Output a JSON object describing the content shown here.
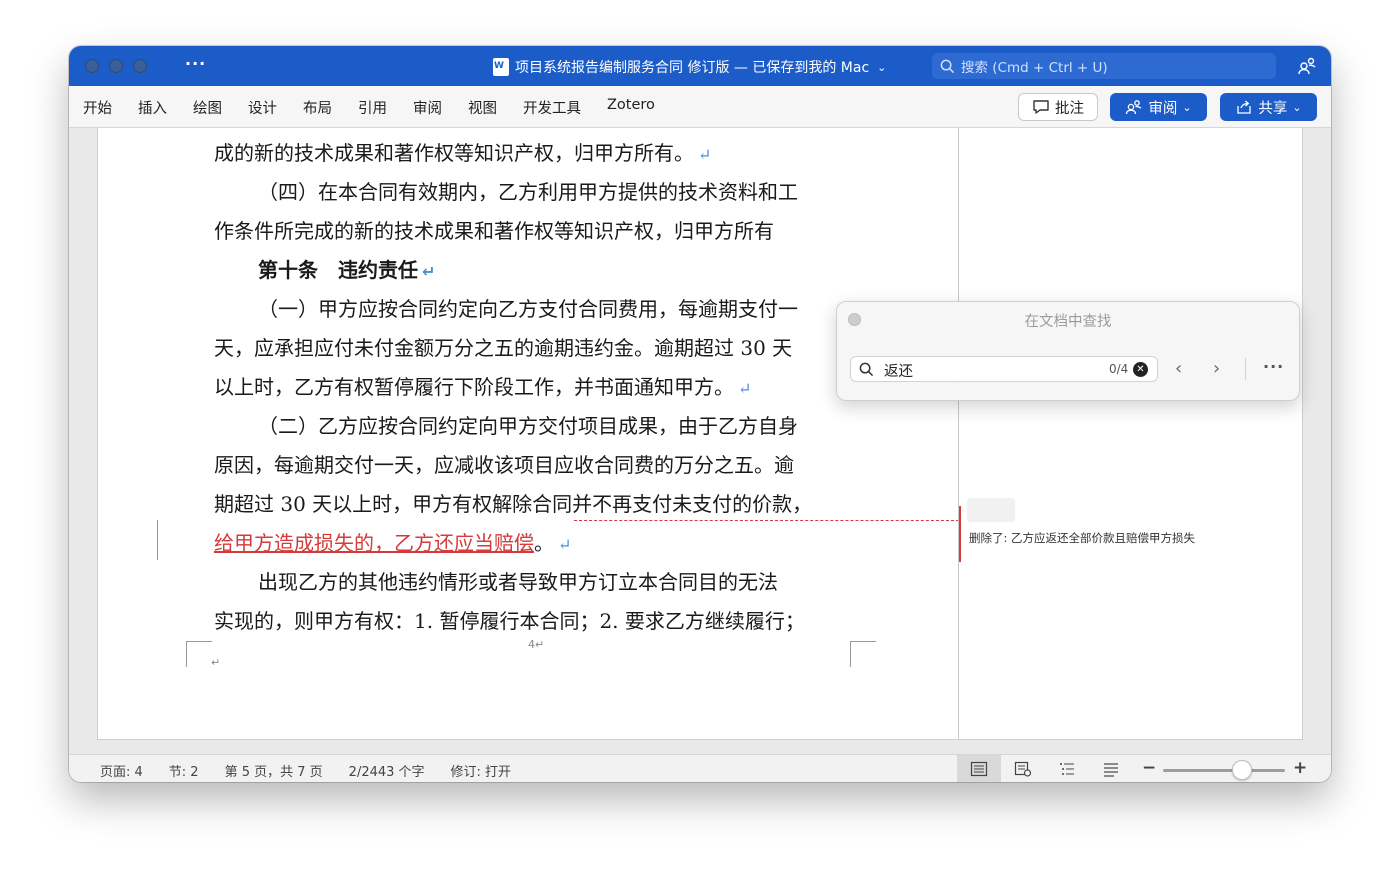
{
  "window": {
    "title": "项目系统报告编制服务合同 修订版 — 已保存到我的 Mac",
    "search_placeholder": "搜索 (Cmd + Ctrl + U)"
  },
  "ribbon": {
    "tabs": [
      "开始",
      "插入",
      "绘图",
      "设计",
      "布局",
      "引用",
      "审阅",
      "视图",
      "开发工具",
      "Zotero"
    ],
    "comment_label": "批注",
    "review_label": "审阅",
    "share_label": "共享"
  },
  "document": {
    "lines": [
      "成的新的技术成果和著作权等知识产权，归甲方所有。",
      "（四）在本合同有效期内，乙方利用甲方提供的技术资料和工",
      "作条件所完成的新的技术成果和著作权等知识产权，归甲方所有",
      "第十条　违约责任",
      "（一）甲方应按合同约定向乙方支付合同费用，每逾期支付一",
      "天，应承担应付未付金额万分之五的逾期违约金。逾期超过 30 天",
      "以上时，乙方有权暂停履行下阶段工作，并书面通知甲方。",
      "（二）乙方应按合同约定向甲方交付项目成果，由于乙方自身",
      "原因，每逾期交付一天，应减收该项目应收合同费的万分之五。逾",
      "期超过 30 天以上时，甲方有权解除合同并不再支付未支付的价款，",
      "给甲方造成损失的，乙方还应当赔偿",
      "出现乙方的其他违约情形或者导致甲方订立本合同目的无法",
      "实现的，则甲方有权：1. 暂停履行本合同；2. 要求乙方继续履行；"
    ],
    "inserted_suffix": "。",
    "paragraph_mark": "↵",
    "page_number": "4↵",
    "small_mark": "↵"
  },
  "markup": {
    "deleted_text": "删除了: 乙方应返还全部价款且赔偿甲方损失"
  },
  "find_panel": {
    "title": "在文档中查找",
    "query": "返还",
    "count": "0/4"
  },
  "statusbar": {
    "page": "页面: 4",
    "section": "节: 2",
    "page_of": "第 5 页，共 7 页",
    "words": "2/2443 个字",
    "track": "修订: 打开"
  },
  "zoom": {
    "level": 0.65
  },
  "colors": {
    "accent": "#1c5cc9",
    "insert": "#d63a3a",
    "para_mark": "#4a90d9"
  }
}
